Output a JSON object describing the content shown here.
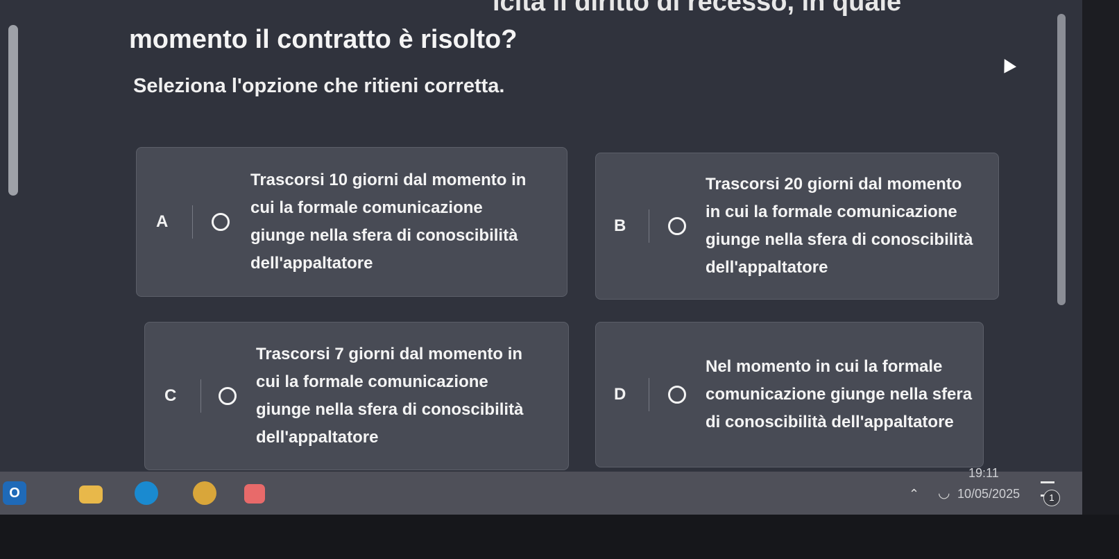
{
  "header": {
    "partial_title": "icita il diritto di recesso, in quale",
    "question": "momento il contratto è risolto?",
    "instruction": "Seleziona l'opzione che ritieni corretta."
  },
  "options": [
    {
      "letter": "A",
      "lines": [
        "Trascorsi 10 giorni dal momento in",
        "cui la formale comunicazione",
        "giunge nella sfera di conoscibilità",
        "dell'appaltatore"
      ]
    },
    {
      "letter": "B",
      "lines": [
        "Trascorsi 20 giorni dal momento",
        "in cui la formale comunicazione",
        "giunge nella sfera di conoscibilità",
        "dell'appaltatore"
      ]
    },
    {
      "letter": "C",
      "lines": [
        "Trascorsi 7 giorni dal momento in",
        "cui la formale comunicazione",
        "giunge nella sfera di conoscibilità",
        "dell'appaltatore"
      ]
    },
    {
      "letter": "D",
      "lines": [
        "Nel momento in cui la formale",
        "comunicazione giunge nella sfera",
        "di conoscibilità dell'appaltatore"
      ]
    }
  ],
  "taskbar": {
    "time": "19:11",
    "date": "10/05/2025",
    "notification_count": "1",
    "outlook_label": "O",
    "icons": [
      "outlook-icon",
      "file-explorer-icon",
      "edge-icon",
      "chrome-icon",
      "app-icon",
      "chevron-up-icon",
      "wifi-icon",
      "notification-icon"
    ]
  },
  "colors": {
    "background": "#30333d",
    "option_card": "#484b55",
    "taskbar": "#4f5059"
  }
}
